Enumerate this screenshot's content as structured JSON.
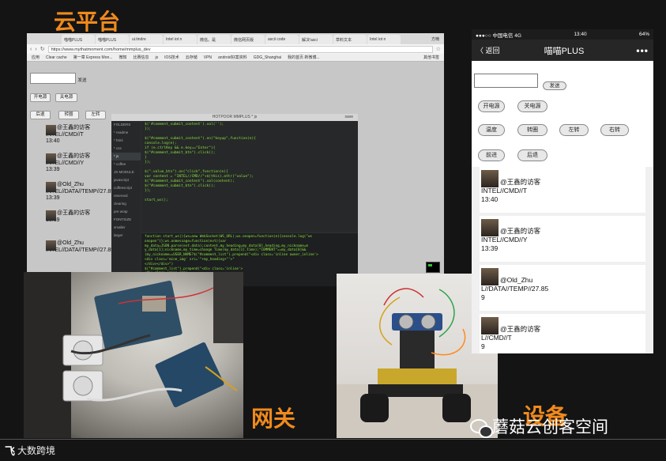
{
  "labels": {
    "cloud": "云平台",
    "gateway": "网关",
    "device": "设备"
  },
  "browser": {
    "tabs": [
      "喵喵PLUS",
      "喵喵PLUS",
      "ui.tindre",
      "Intel iot n",
      "微信。是",
      "微信网页版",
      "ascii code",
      "解决'asci",
      "草料文本",
      "Intel iot n"
    ],
    "user": "方楠",
    "url": "https://www.mythatmoment.com/home/mmplus_dev",
    "bookmarks": [
      "应用",
      "Clear cache",
      "第一章 Express Mon...",
      "微知",
      "比赛信息",
      "js",
      "IOS技术",
      "云存储",
      "VPN",
      "android好案资料",
      "GDG_Shanghai",
      "我的首页 新微博..."
    ],
    "bookmarks_other": "其他书签",
    "page": {
      "send": "发送",
      "power_on": "开电源",
      "power_off": "关电源",
      "backward": "后退",
      "turn_around": "转圈",
      "left": "左转",
      "messages": [
        {
          "name": "@王鑫的访客",
          "cmd": "INTEL//CMD//T",
          "time": "13:40"
        },
        {
          "name": "@王鑫的访客",
          "cmd": "INTEL//CMD//Y",
          "time": "13:39"
        },
        {
          "name": "@Old_Zhu",
          "cmd": "INTEL//DATA//TEMP//27.85",
          "time": "13:39"
        },
        {
          "name": "@王鑫的访客",
          "cmd": "",
          "time": "13:39"
        },
        {
          "name": "@Old_Zhu",
          "cmd": "INTEL//DATA//TEMP//27.85",
          "time": ""
        }
      ]
    }
  },
  "editor": {
    "title": "HOTPOOR MMPLUS * js",
    "save": "save",
    "sidebar": [
      "FOLDERS",
      "* readme",
      "* html",
      "* css",
      "* js",
      "* coffee",
      "JS MODULE",
      "javascript",
      "coffeescript",
      "reserved",
      "clearing",
      "pre wrap",
      "FONTSIZE",
      "smaller",
      "larger"
    ],
    "code": "$('#comment_submit_content').val('');\n});\n\n$(\"#comment_submit_content\").on(\"keyup\",function(e){\nconsole.log(e);\nif (e.ctrlKey && e.key==\"Enter\"){\n$(\"#comment_submit_btn\").click();\n}\n});\n\n$(\".value_btn\").on(\"click\",function(e){\nvar content = \"INTEL//CMD//\"+$(this).attr(\"value\");\n$(\"#comment_submit_content\").val(content);\n$(\"#comment_submit_btn\").click();\n});\n\nstart_ws();",
    "console": "function start_ws(){ws=new WebSocket(WS_URL);ws.onopen=function(e){console.log(\"ws\nonopen\")};ws.onmessage=function(evt){var\nmy_data=JSON.parse(evt.data);content,my_heading=my_data[0],heading,my_nickname=m\ny_data[1];nickname,my_time=change Time(my_data[1].time);\"COMMENT\"==my_data[0]&&\n(my_nickname==USER_NAME?$(\"#comment_list\").prepend(\"<div class='inline owner_inline'>\n<div class='mine_img' src='\"+my_heading+\"'>\"\n</div></div>\")\n$(\"#comment_list\").prepend(\"<div class='inline'>\n<div class='mine_img'"
  },
  "phone": {
    "carrier": "●●●○○ 中国电信 4G",
    "time": "13:40",
    "battery": "64%",
    "back": "〈 返回",
    "title": "喵喵PLUS",
    "more": "•••",
    "send": "发送",
    "buttons": {
      "power_on": "开电源",
      "power_off": "关电源",
      "warm": "温度",
      "turn_around": "转圈",
      "left": "左转",
      "right": "右转",
      "forward": "前进",
      "backward": "后退"
    },
    "messages": [
      {
        "name": "@王鑫的访客",
        "cmd": "INTEL//CMD//T",
        "time": "13:40"
      },
      {
        "name": "@王鑫的访客",
        "cmd": "INTEL//CMD//Y",
        "time": "13:39"
      },
      {
        "name": "@Old_Zhu",
        "cmd": "L//DATA//TEMP//27.85",
        "time": "9"
      },
      {
        "name": "@王鑫的访客",
        "cmd": "L//CMD//T",
        "time": "9"
      }
    ]
  },
  "footer": {
    "logo_mark": "飞",
    "logo_text": "大数跨境",
    "watermark": "蘑菇云创客空间"
  }
}
